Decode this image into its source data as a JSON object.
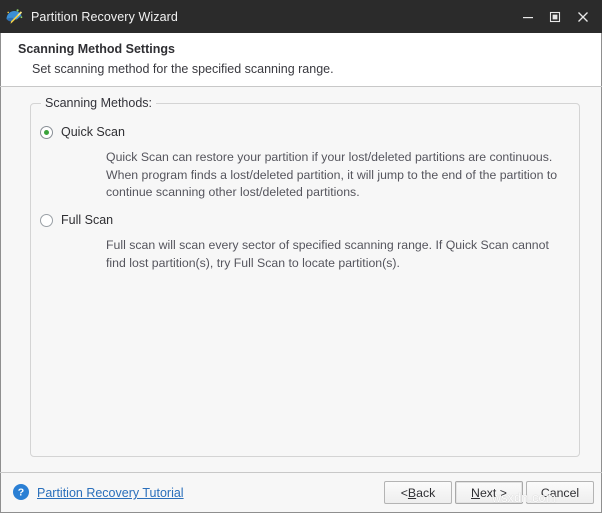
{
  "window": {
    "title": "Partition Recovery Wizard",
    "app_icon": "wizard-wand-icon",
    "controls": {
      "minimize": "minimize-icon",
      "maximize": "maximize-icon",
      "close": "close-icon"
    }
  },
  "header": {
    "title": "Scanning Method Settings",
    "subtitle": "Set scanning method for the specified scanning range."
  },
  "groupbox": {
    "legend": "Scanning Methods:",
    "options": [
      {
        "label": "Quick Scan",
        "selected": true,
        "description": "Quick Scan can restore your partition if your lost/deleted partitions are continuous. When program finds a lost/deleted partition, it will jump to the end of the partition to continue scanning other lost/deleted partitions."
      },
      {
        "label": "Full Scan",
        "selected": false,
        "description": "Full scan will scan every sector of specified scanning range. If Quick Scan cannot find lost partition(s), try Full Scan to locate partition(s)."
      }
    ]
  },
  "footer": {
    "help_icon": "help-question-icon",
    "tutorial_link": "Partition Recovery Tutorial",
    "buttons": {
      "back": "< Back",
      "back_pre": "< ",
      "back_mnemonic": "B",
      "back_post": "ack",
      "next_pre": "",
      "next_mnemonic": "N",
      "next_post": "ext >",
      "cancel": "Cancel"
    }
  },
  "watermark": "wsxdn.com",
  "colors": {
    "titlebar": "#2b2b2b",
    "radio_selected": "#3ba33b",
    "link": "#2a6fbb",
    "help_icon": "#2a7fd4"
  }
}
